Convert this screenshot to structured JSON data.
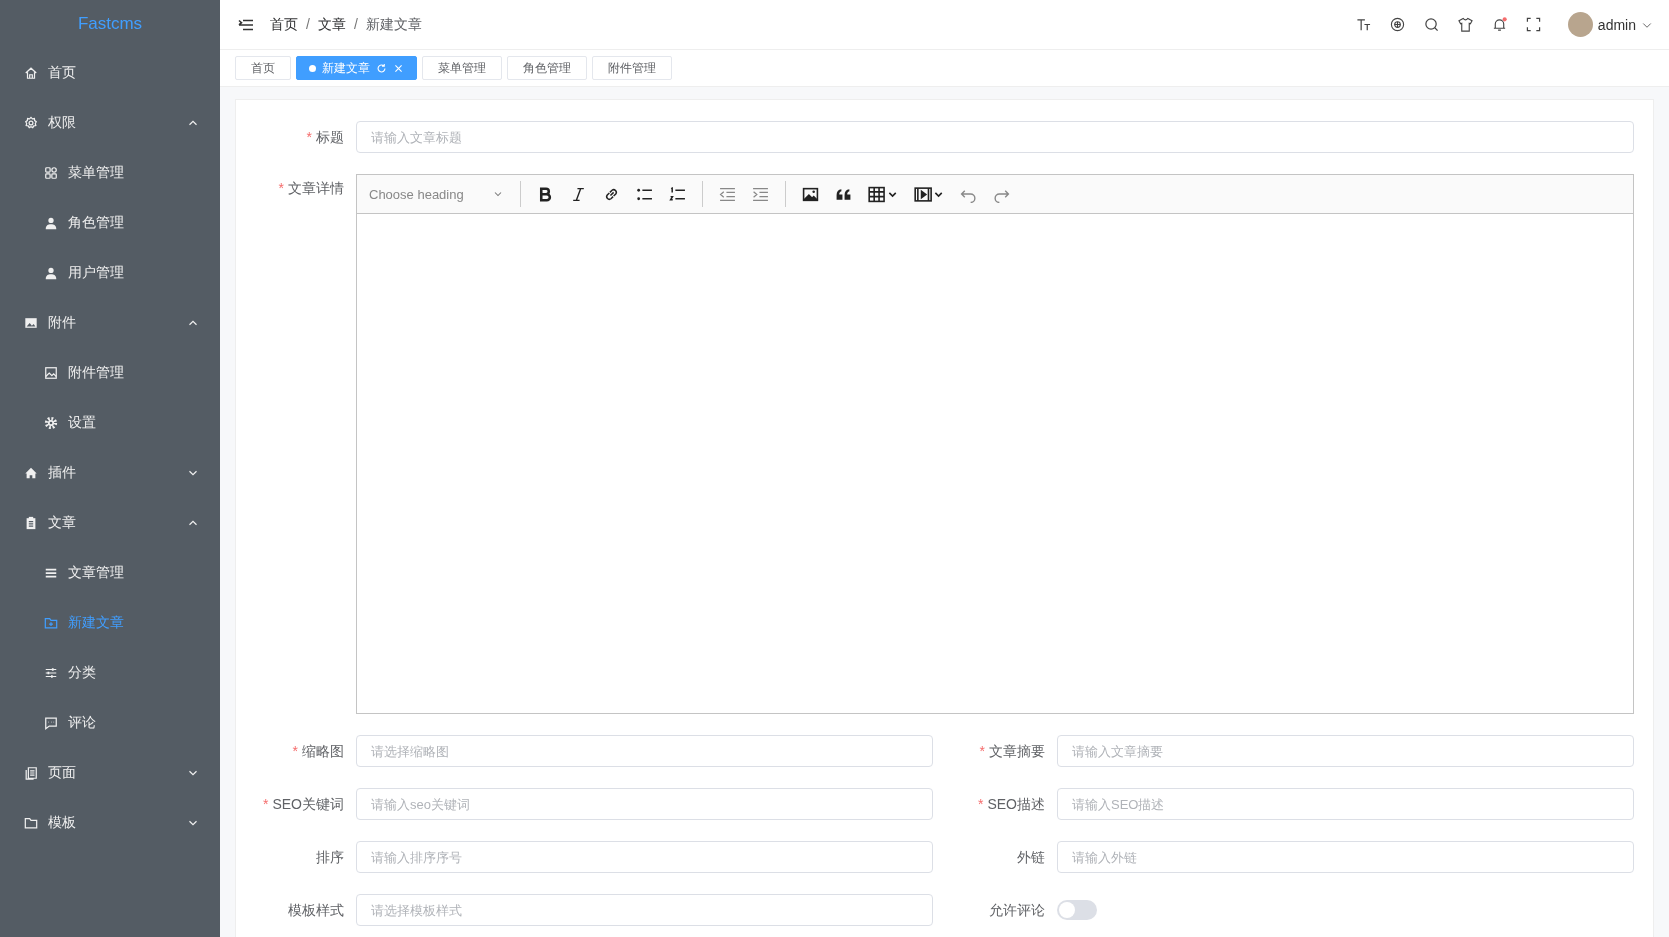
{
  "sidebar": {
    "logo": "Fastcms",
    "items": [
      {
        "label": "首页",
        "selected": false
      },
      {
        "label": "权限",
        "expanded": true,
        "children": [
          {
            "label": "菜单管理",
            "selected": false
          },
          {
            "label": "角色管理",
            "selected": false
          },
          {
            "label": "用户管理",
            "selected": false
          }
        ]
      },
      {
        "label": "附件",
        "expanded": true,
        "children": [
          {
            "label": "附件管理",
            "selected": false
          },
          {
            "label": "设置",
            "selected": false
          }
        ]
      },
      {
        "label": "插件",
        "expanded": false
      },
      {
        "label": "文章",
        "expanded": true,
        "children": [
          {
            "label": "文章管理",
            "selected": false
          },
          {
            "label": "新建文章",
            "selected": true
          },
          {
            "label": "分类",
            "selected": false
          },
          {
            "label": "评论",
            "selected": false
          }
        ]
      },
      {
        "label": "页面",
        "expanded": false
      },
      {
        "label": "模板",
        "expanded": false
      }
    ]
  },
  "header": {
    "breadcrumb": [
      "首页",
      "文章",
      "新建文章"
    ],
    "separator": "/",
    "user": "admin"
  },
  "required_mark": "*",
  "tabs": [
    {
      "label": "首页",
      "selected": false
    },
    {
      "label": "新建文章",
      "selected": true
    },
    {
      "label": "菜单管理",
      "selected": false
    },
    {
      "label": "角色管理",
      "selected": false
    },
    {
      "label": "附件管理",
      "selected": false
    }
  ],
  "form": {
    "title": {
      "label": "标题",
      "required": true,
      "placeholder": "请输入文章标题"
    },
    "content": {
      "label": "文章详情",
      "required": true,
      "heading_placeholder": "Choose heading"
    },
    "fields": [
      {
        "kind": "input",
        "label": "缩略图",
        "required": true,
        "placeholder": "请选择缩略图"
      },
      {
        "kind": "input",
        "label": "文章摘要",
        "required": true,
        "placeholder": "请输入文章摘要"
      },
      {
        "kind": "input",
        "label": "SEO关键词",
        "required": true,
        "placeholder": "请输入seo关键词"
      },
      {
        "kind": "input",
        "label": "SEO描述",
        "required": true,
        "placeholder": "请输入SEO描述"
      },
      {
        "kind": "input",
        "label": "排序",
        "required": false,
        "placeholder": "请输入排序序号"
      },
      {
        "kind": "input",
        "label": "外链",
        "required": false,
        "placeholder": "请输入外链"
      },
      {
        "kind": "input",
        "label": "模板样式",
        "required": false,
        "placeholder": "请选择模板样式"
      },
      {
        "kind": "toggle",
        "label": "允许评论",
        "required": false,
        "on": false
      }
    ]
  }
}
